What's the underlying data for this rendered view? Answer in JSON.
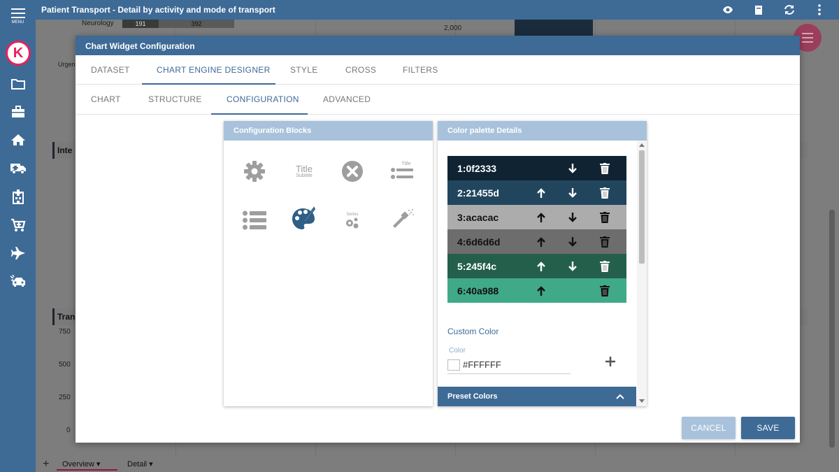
{
  "app": {
    "menu_label": "MENU",
    "logo_letter": "K",
    "title": "Patient Transport - Detail by activity and mode of transport"
  },
  "sidebar_icons": [
    "folder-icon",
    "briefcase-icon",
    "home-icon",
    "ambulance-icon",
    "hospital-icon",
    "cart-icon",
    "airplane-icon",
    "car-crash-icon"
  ],
  "background": {
    "neurology_label": "Neurology",
    "neurology_v1": "191",
    "neurology_v2": "392",
    "urgent_label": "Urgen",
    "y_2000": "2,000",
    "panel1_title": "Inte",
    "panel2_title": "Tran",
    "y_ticks": [
      "750",
      "500",
      "250",
      "0"
    ]
  },
  "bottom_tabs": {
    "overview": "Overview",
    "detail": "Detail"
  },
  "modal": {
    "title": "Chart Widget Configuration",
    "tabs": [
      "DATASET",
      "CHART ENGINE DESIGNER",
      "STYLE",
      "CROSS",
      "FILTERS"
    ],
    "subtabs": [
      "CHART",
      "STRUCTURE",
      "CONFIGURATION",
      "ADVANCED"
    ],
    "config_blocks_title": "Configuration Blocks",
    "block_title_text": "Title",
    "block_subtitle_text": "Subtitle",
    "block_title_small": "Title",
    "block_series_text": "Series",
    "palette_title": "Color palette Details",
    "palette": [
      {
        "label": "1:0f2333",
        "color": "#0f2333",
        "text": "#ffffff",
        "up": false,
        "down": true
      },
      {
        "label": "2:21455d",
        "color": "#21455d",
        "text": "#ffffff",
        "up": true,
        "down": true
      },
      {
        "label": "3:acacac",
        "color": "#acacac",
        "text": "#111111",
        "up": true,
        "down": true
      },
      {
        "label": "4:6d6d6d",
        "color": "#6d6d6d",
        "text": "#111111",
        "up": true,
        "down": true
      },
      {
        "label": "5:245f4c",
        "color": "#245f4c",
        "text": "#ffffff",
        "up": true,
        "down": true
      },
      {
        "label": "6:40a988",
        "color": "#40a988",
        "text": "#111111",
        "up": true,
        "down": false
      }
    ],
    "custom_color_label": "Custom Color",
    "color_field_label": "Color",
    "color_value": "#FFFFFF",
    "preset_colors_label": "Preset Colors",
    "cancel_label": "CANCEL",
    "save_label": "SAVE"
  },
  "colors": {
    "primary": "#3e6a96",
    "panel_title_bg": "#a9c2dc",
    "cancel_bg": "#a9c2dc",
    "accent_pink": "#e8215b"
  }
}
